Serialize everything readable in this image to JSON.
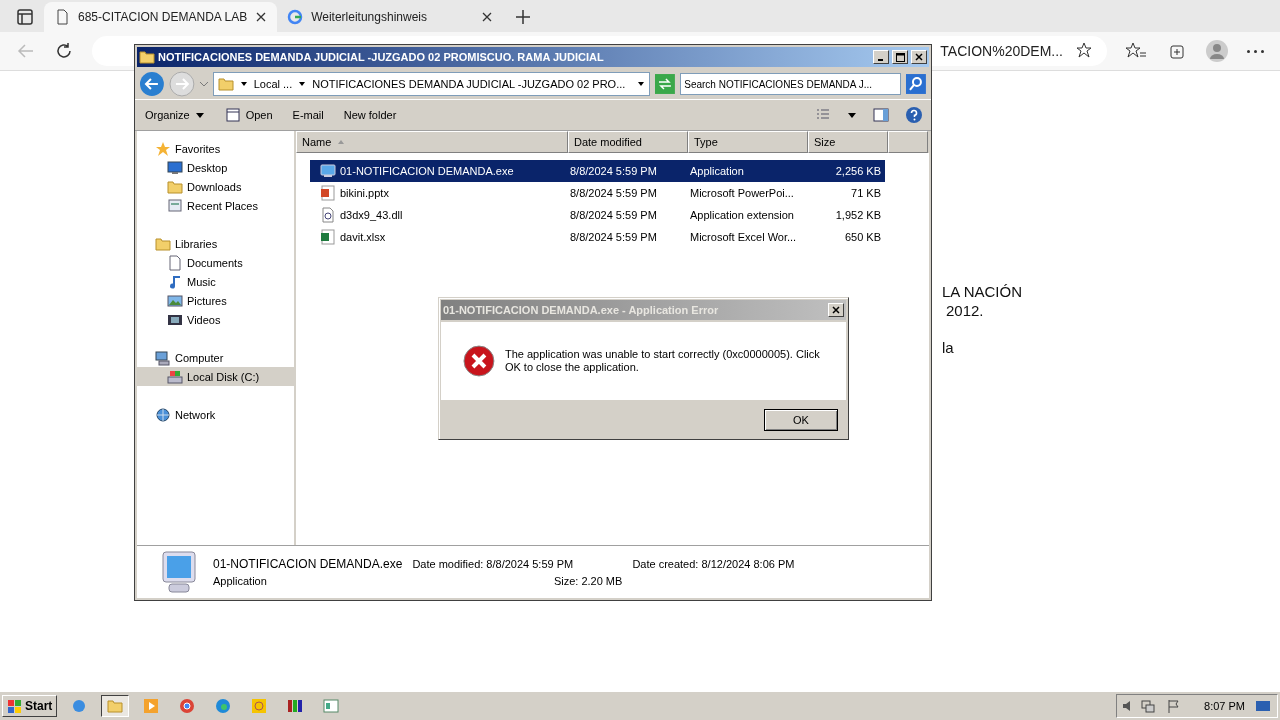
{
  "browser": {
    "tabs": [
      {
        "label": "685-CITACION DEMANDA LAB",
        "selected": true
      },
      {
        "label": "Weiterleitungshinweis",
        "selected": false
      }
    ],
    "address": "TACION%20DEM...",
    "page_lines": [
      "LA NACIÓN",
      "2012.",
      "la"
    ]
  },
  "explorer": {
    "title": "NOTIFICACIONES DEMANDA JUDICIAL -JUZGADO 02 PROMISCUO. RAMA JUDICIAL",
    "breadcrumb": [
      "Local ...",
      "NOTIFICACIONES DEMANDA JUDICIAL -JUZGADO 02 PRO..."
    ],
    "search": {
      "placeholder": "Search NOTIFICACIONES DEMANDA J..."
    },
    "toolbar": [
      {
        "label": "Organize",
        "kind": "menu"
      },
      {
        "label": "Open",
        "kind": "icon"
      },
      {
        "label": "E-mail",
        "kind": "plain"
      },
      {
        "label": "New folder",
        "kind": "plain"
      }
    ],
    "nav": [
      {
        "label": "Favorites",
        "kind": "star",
        "selected": false,
        "children": [
          {
            "label": "Desktop",
            "kind": "desktop",
            "selected": false
          },
          {
            "label": "Downloads",
            "kind": "folder",
            "selected": false
          },
          {
            "label": "Recent Places",
            "kind": "recent",
            "selected": false
          }
        ]
      },
      {
        "label": "Libraries",
        "kind": "folder",
        "selected": false,
        "children": [
          {
            "label": "Documents",
            "kind": "doc",
            "selected": false
          },
          {
            "label": "Music",
            "kind": "music",
            "selected": false
          },
          {
            "label": "Pictures",
            "kind": "pictures",
            "selected": false
          },
          {
            "label": "Videos",
            "kind": "video",
            "selected": false
          }
        ]
      },
      {
        "label": "Computer",
        "kind": "computer",
        "selected": false,
        "children": [
          {
            "label": "Local Disk (C:)",
            "kind": "disk",
            "selected": true
          }
        ]
      },
      {
        "label": "Network",
        "kind": "network",
        "selected": false
      }
    ],
    "columns": [
      "Name",
      "Date modified",
      "Type",
      "Size"
    ],
    "rows": [
      {
        "name": "01-NOTIFICACION DEMANDA.exe",
        "kind": "exe",
        "date": "8/8/2024 5:59 PM",
        "type": "Application",
        "size": "2,256 KB",
        "selected": true
      },
      {
        "name": "bikini.pptx",
        "kind": "pptx",
        "date": "8/8/2024 5:59 PM",
        "type": "Microsoft PowerPoi...",
        "size": "71 KB",
        "selected": false
      },
      {
        "name": "d3dx9_43.dll",
        "kind": "dll",
        "date": "8/8/2024 5:59 PM",
        "type": "Application extension",
        "size": "1,952 KB",
        "selected": false
      },
      {
        "name": "davit.xlsx",
        "kind": "xlsx",
        "date": "8/8/2024 5:59 PM",
        "type": "Microsoft Excel Wor...",
        "size": "650 KB",
        "selected": false
      }
    ],
    "details": {
      "name": "01-NOTIFICACION DEMANDA.exe",
      "type": "Application",
      "modified": "Date modified: 8/8/2024 5:59 PM",
      "size": "Size: 2.20 MB",
      "created": "Date created: 8/12/2024 8:06 PM"
    }
  },
  "dialog": {
    "title": "01-NOTIFICACION DEMANDA.exe - Application Error",
    "message": "The application was unable to start correctly (0xc0000005). Click OK to close the application.",
    "button": "OK"
  },
  "taskbar": {
    "start": "Start",
    "clock": "8:07 PM"
  }
}
